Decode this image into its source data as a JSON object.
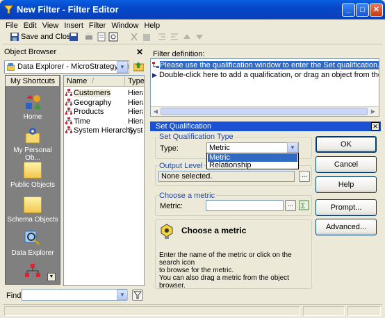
{
  "window": {
    "title": "New Filter - Filter Editor"
  },
  "menu": [
    "File",
    "Edit",
    "View",
    "Insert",
    "Filter",
    "Window",
    "Help"
  ],
  "toolbar": {
    "save_close_label": "Save and Close"
  },
  "object_browser": {
    "title": "Object Browser",
    "location": "Data Explorer - MicroStrategy Tutoria",
    "shortcuts_header": "My Shortcuts",
    "shortcuts": [
      "Home",
      "My Personal Ob...",
      "Public Objects",
      "Schema Objects",
      "Data Explorer"
    ],
    "columns": {
      "name": "Name",
      "type": "Type"
    },
    "rows": [
      {
        "name": "Customers",
        "type": "Hiera"
      },
      {
        "name": "Geography",
        "type": "Hiera"
      },
      {
        "name": "Products",
        "type": "Hiera"
      },
      {
        "name": "Time",
        "type": "Hiera"
      },
      {
        "name": "System Hierarchy",
        "type": "Syste"
      }
    ],
    "find_label": "Find:"
  },
  "filter_definition": {
    "label": "Filter definition:",
    "line1": "Please use the qualification window to enter the Set qualification.",
    "line2": "Double-click here to add a qualification, or drag an object from the object browser."
  },
  "set_qualification": {
    "title": "Set Qualification",
    "type_group_label": "Set Qualification Type",
    "type_label": "Type:",
    "type_value": "Metric",
    "type_options": [
      "Metric",
      "Relationship"
    ],
    "output_group_label": "Output Level",
    "output_value": "None selected.",
    "metric_group_label": "Choose a metric",
    "metric_label": "Metric:",
    "metric_value": "",
    "help_title": "Choose a metric",
    "help_text": [
      "Enter the name of the metric or click on the search icon",
      "to browse for the metric.",
      "You can also drag a metric from the object browser."
    ],
    "buttons": {
      "ok": "OK",
      "cancel": "Cancel",
      "help": "Help",
      "prompt": "Prompt...",
      "advanced": "Advanced..."
    }
  },
  "colors": {
    "titlebar": "#0a3fb8",
    "selection": "#316ac5",
    "panel_bg": "#ece9d8",
    "shortcuts_bg": "#808080"
  }
}
